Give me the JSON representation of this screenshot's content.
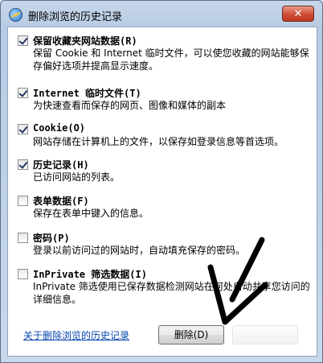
{
  "window": {
    "title": "删除浏览的历史记录",
    "close_glyph": "✕"
  },
  "options": [
    {
      "title": "保留收藏夹网站数据(R)",
      "desc": "保留 Cookie 和 Internet 临时文件，可以使您收藏的网站能够保存偏好选项并提高显示速度。",
      "checked": true
    },
    {
      "title": "Internet 临时文件(T)",
      "desc": "为快速查看而保存的网页、图像和媒体的副本",
      "checked": true
    },
    {
      "title": "Cookie(O)",
      "desc": "网站存储在计算机上的文件，以保存如登录信息等首选项。",
      "checked": true
    },
    {
      "title": "历史记录(H)",
      "desc": "已访问网站的列表。",
      "checked": true
    },
    {
      "title": "表单数据(F)",
      "desc": "保存在表单中键入的信息。",
      "checked": false
    },
    {
      "title": "密码(P)",
      "desc": "登录以前访问过的网站时，自动填充保存的密码。",
      "checked": false
    },
    {
      "title": "InPrivate 筛选数据(I)",
      "desc": "InPrivate 筛选使用已保存数据检测网站在何处自动共享您访问的详细信息。",
      "checked": false
    }
  ],
  "footer": {
    "link": "关于删除浏览的历史记录",
    "delete_button": "删除(D)"
  }
}
